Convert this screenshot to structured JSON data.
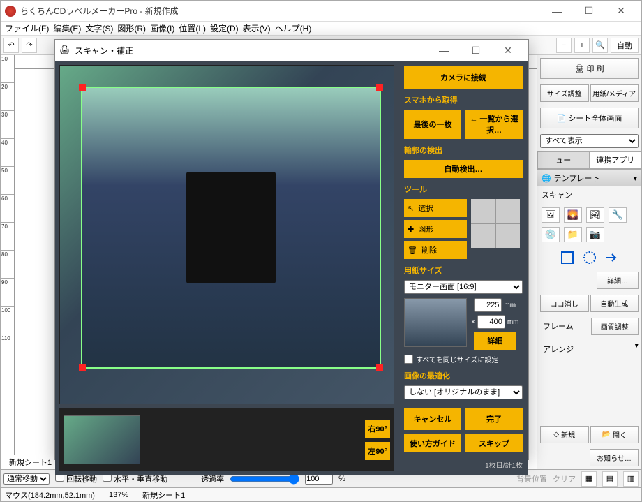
{
  "main": {
    "title": "らくちんCDラベルメーカーPro - 新規作成",
    "menu": [
      "ファイル(F)",
      "編集(E)",
      "文字(S)",
      "図形(R)",
      "画像(I)",
      "位置(L)",
      "設定(D)",
      "表示(V)",
      "ヘルプ(H)"
    ],
    "toolbar_auto": "自動",
    "sheet_tab": "新規シート1"
  },
  "ruler_v": [
    "10",
    "20",
    "30",
    "40",
    "50",
    "60",
    "70",
    "80",
    "90",
    "100",
    "110"
  ],
  "right": {
    "print": "印 刷",
    "size_adjust": "サイズ調整",
    "paper_media": "用紙/メディア",
    "sheet_full": "シート全体画面",
    "display_all": "すべて表示",
    "tab_view": "ュー",
    "tab_apps": "連携アプリ",
    "template": "テンプレート",
    "scan": "スキャン",
    "detail": "詳細…",
    "koko": "ココ消し",
    "autogen": "自動生成",
    "frame": "フレーム",
    "quality": "画質調整",
    "arrange": "アレンジ",
    "new": "新規",
    "open": "開く",
    "notice": "お知らせ…"
  },
  "bottom": {
    "move_mode": "通常移動",
    "rotate_move": "回転移動",
    "hv_move": "水平・垂直移動",
    "opacity_label": "透過率",
    "opacity_val": "100",
    "pct": "%",
    "bg_pos": "背景位置",
    "clear": "クリア"
  },
  "status": {
    "mouse": "マウス(184.2mm,52.1mm)",
    "zoom": "137%",
    "sheet": "新規シート1"
  },
  "dialog": {
    "title": "スキャン・補正",
    "connect_camera": "カメラに接続",
    "from_phone": "スマホから取得",
    "last_one": "最後の一枚",
    "from_list": "← 一覧から選択…",
    "contour": "輪郭の検出",
    "auto_detect": "自動検出…",
    "tools": "ツール",
    "tool_select": "選択",
    "tool_shape": "図形",
    "tool_delete": "削除",
    "paper_size": "用紙サイズ",
    "paper_preset": "モニター画面 [16:9]",
    "width": "225",
    "height": "400",
    "unit": "mm",
    "times": "×",
    "detail": "詳細",
    "same_size": "すべてを同じサイズに設定",
    "optimize": "画像の最適化",
    "optimize_val": "しない [オリジナルのまま]",
    "cancel": "キャンセル",
    "done": "完了",
    "guide": "使い方ガイド",
    "skip": "スキップ",
    "rot_r": "右90°",
    "rot_l": "左90°",
    "count": "1枚目/計1枚"
  }
}
